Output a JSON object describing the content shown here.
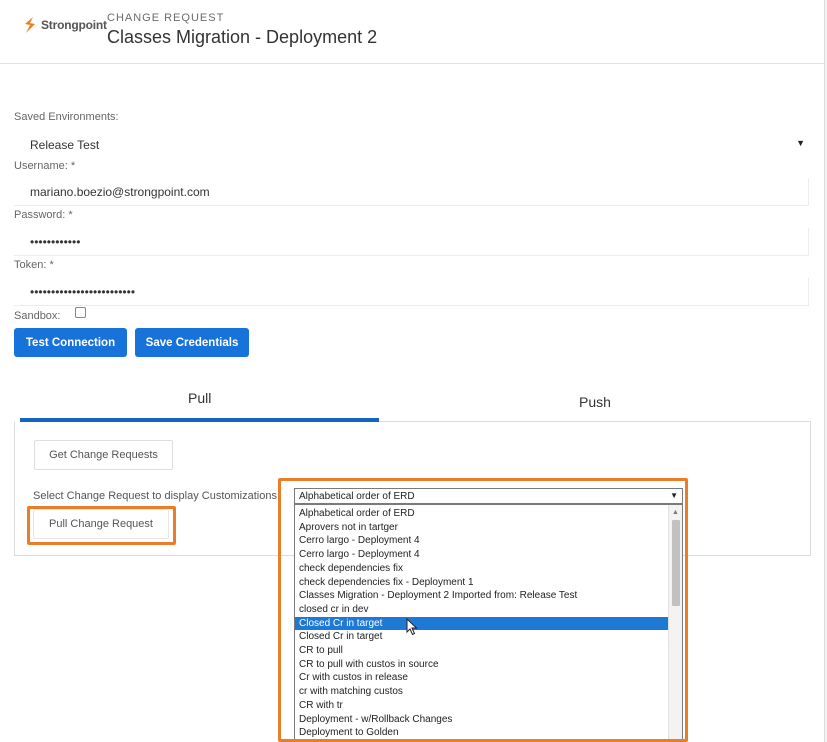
{
  "header": {
    "logo_text": "Strongpoint",
    "section": "CHANGE REQUEST",
    "title": "Classes Migration - Deployment 2"
  },
  "form": {
    "saved_env_label": "Saved Environments:",
    "saved_env_value": "Release Test",
    "username_label": "Username: *",
    "username_value": "mariano.boezio@strongpoint.com",
    "password_label": "Password: *",
    "password_value": "••••••••••••",
    "token_label": "Token: *",
    "token_value": "•••••••••••••••••••••••••",
    "sandbox_label": "Sandbox:",
    "sandbox_checked": false
  },
  "buttons": {
    "test_connection": "Test Connection",
    "save_credentials": "Save Credentials",
    "get_change_requests": "Get Change Requests",
    "pull_change_request": "Pull Change Request"
  },
  "tabs": {
    "pull": "Pull",
    "push": "Push",
    "active": "Pull"
  },
  "dropdown": {
    "label": "Select Change Request to display Customizations:",
    "selected": "Alphabetical order of ERD",
    "options": [
      "Alphabetical order of ERD",
      "Aprovers not in tartger",
      "Cerro largo - Deployment 4",
      "Cerro largo - Deployment 4",
      "check dependencies fix",
      "check dependencies fix - Deployment 1",
      "Classes Migration - Deployment 2 Imported from: Release Test",
      "closed cr in dev",
      "Closed Cr in target",
      "Closed Cr in target",
      "CR to pull",
      "CR to pull with custos in source",
      "Cr with custos in release",
      "cr with matching custos",
      "CR with tr",
      "Deployment - w/Rollback Changes",
      "Deployment to Golden"
    ],
    "highlighted_option": "Closed Cr in target"
  },
  "colors": {
    "primary": "#1773d9",
    "highlight_box": "#ea7d2a",
    "tab_active": "#1565c0",
    "logo_orange": "#ef7d22"
  }
}
